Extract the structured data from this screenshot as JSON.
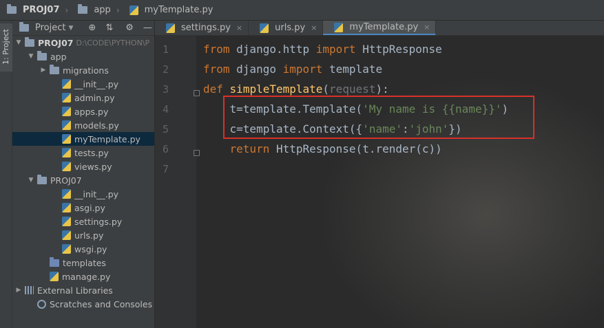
{
  "breadcrumb": {
    "project": "PROJ07",
    "folder": "app",
    "file": "myTemplate.py"
  },
  "left_strip": {
    "label": "1: Project"
  },
  "project_panel": {
    "title": "Project",
    "tree": [
      {
        "indent": 0,
        "expanded": true,
        "icon": "folder-icon",
        "label": "PROJ07",
        "hint": "D:\\CODE\\PYTHON\\P",
        "bold": true
      },
      {
        "indent": 1,
        "expanded": true,
        "icon": "folder-icon",
        "label": "app"
      },
      {
        "indent": 2,
        "expanded": false,
        "icon": "folder-icon",
        "label": "migrations"
      },
      {
        "indent": 3,
        "icon": "python-file-icon",
        "label": "__init__.py"
      },
      {
        "indent": 3,
        "icon": "python-file-icon",
        "label": "admin.py"
      },
      {
        "indent": 3,
        "icon": "python-file-icon",
        "label": "apps.py"
      },
      {
        "indent": 3,
        "icon": "python-file-icon",
        "label": "models.py"
      },
      {
        "indent": 3,
        "icon": "python-file-icon",
        "label": "myTemplate.py",
        "selected": true
      },
      {
        "indent": 3,
        "icon": "python-file-icon",
        "label": "tests.py"
      },
      {
        "indent": 3,
        "icon": "python-file-icon",
        "label": "views.py"
      },
      {
        "indent": 1,
        "expanded": true,
        "icon": "folder-icon",
        "label": "PROJ07"
      },
      {
        "indent": 3,
        "icon": "python-file-icon",
        "label": "__init__.py"
      },
      {
        "indent": 3,
        "icon": "python-file-icon",
        "label": "asgi.py"
      },
      {
        "indent": 3,
        "icon": "python-file-icon",
        "label": "settings.py"
      },
      {
        "indent": 3,
        "icon": "python-file-icon",
        "label": "urls.py"
      },
      {
        "indent": 3,
        "icon": "python-file-icon",
        "label": "wsgi.py"
      },
      {
        "indent": 2,
        "icon": "folder-blue-icon",
        "label": "templates"
      },
      {
        "indent": 2,
        "icon": "python-file-icon",
        "label": "manage.py"
      },
      {
        "indent": 0,
        "expanded": false,
        "icon": "library-icon",
        "label": "External Libraries"
      },
      {
        "indent": 1,
        "icon": "scratches-icon",
        "label": "Scratches and Consoles"
      }
    ]
  },
  "tabs": [
    {
      "label": "settings.py",
      "active": false
    },
    {
      "label": "urls.py",
      "active": false
    },
    {
      "label": "myTemplate.py",
      "active": true
    }
  ],
  "editor": {
    "line_numbers": [
      "1",
      "2",
      "3",
      "4",
      "5",
      "6",
      "7"
    ],
    "lines": [
      [
        {
          "t": "kw",
          "v": "from"
        },
        {
          "t": "txt",
          "v": " django.http "
        },
        {
          "t": "kw",
          "v": "import"
        },
        {
          "t": "txt",
          "v": " HttpResponse"
        }
      ],
      [
        {
          "t": "kw",
          "v": "from"
        },
        {
          "t": "txt",
          "v": " django "
        },
        {
          "t": "kw",
          "v": "import"
        },
        {
          "t": "txt",
          "v": " template"
        }
      ],
      [
        {
          "t": "kw",
          "v": "def"
        },
        {
          "t": "txt",
          "v": " "
        },
        {
          "t": "fn",
          "v": "simpleTemplate"
        },
        {
          "t": "txt",
          "v": "("
        },
        {
          "t": "param",
          "v": "request"
        },
        {
          "t": "txt",
          "v": "):"
        }
      ],
      [
        {
          "t": "txt",
          "v": "    t=template.Template("
        },
        {
          "t": "str",
          "v": "'My name is {{name}}'"
        },
        {
          "t": "txt",
          "v": ")"
        }
      ],
      [
        {
          "t": "txt",
          "v": "    c=template.Context({"
        },
        {
          "t": "str",
          "v": "'name'"
        },
        {
          "t": "txt",
          "v": ":"
        },
        {
          "t": "str",
          "v": "'john'"
        },
        {
          "t": "txt",
          "v": "})"
        }
      ],
      [
        {
          "t": "txt",
          "v": "    "
        },
        {
          "t": "kw",
          "v": "return"
        },
        {
          "t": "txt",
          "v": " HttpResponse(t.render(c))"
        }
      ],
      []
    ]
  },
  "colors": {
    "keyword": "#cc7832",
    "function": "#ffc66d",
    "string": "#6a8759",
    "highlight_box": "#d9302a"
  }
}
